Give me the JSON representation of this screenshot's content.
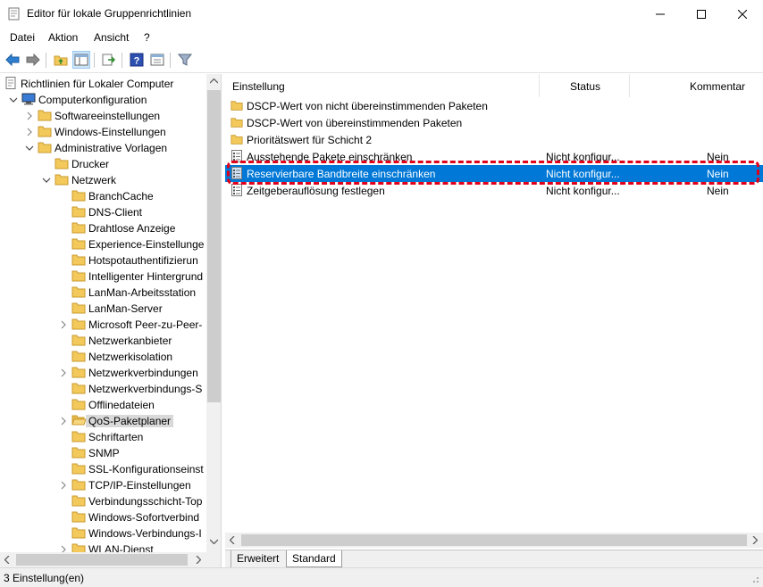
{
  "window": {
    "title": "Editor für lokale Gruppenrichtlinien"
  },
  "menu": [
    "Datei",
    "Aktion",
    "Ansicht",
    "?"
  ],
  "toolbar": {
    "icons": [
      "back-icon",
      "forward-icon",
      "up-folder-icon",
      "show-hide-tree-icon",
      "export-list-icon",
      "help-icon",
      "properties-icon",
      "filter-icon"
    ]
  },
  "tree": [
    {
      "label": "Richtlinien für Lokaler Computer",
      "icon": "policy",
      "expander": ""
    },
    {
      "label": "Computerkonfiguration",
      "icon": "computer",
      "expander": "open"
    },
    {
      "label": "Softwareeinstellungen",
      "icon": "folder",
      "expander": "closed"
    },
    {
      "label": "Windows-Einstellungen",
      "icon": "folder",
      "expander": "closed"
    },
    {
      "label": "Administrative Vorlagen",
      "icon": "folder",
      "expander": "open"
    },
    {
      "label": "Drucker",
      "icon": "folder",
      "expander": ""
    },
    {
      "label": "Netzwerk",
      "icon": "folder",
      "expander": "open"
    },
    {
      "label": "BranchCache",
      "icon": "folder",
      "expander": ""
    },
    {
      "label": "DNS-Client",
      "icon": "folder",
      "expander": ""
    },
    {
      "label": "Drahtlose Anzeige",
      "icon": "folder",
      "expander": ""
    },
    {
      "label": "Experience-Einstellunge",
      "icon": "folder",
      "expander": ""
    },
    {
      "label": "Hotspotauthentifizierun",
      "icon": "folder",
      "expander": ""
    },
    {
      "label": "Intelligenter Hintergrund",
      "icon": "folder",
      "expander": ""
    },
    {
      "label": "LanMan-Arbeitsstation",
      "icon": "folder",
      "expander": ""
    },
    {
      "label": "LanMan-Server",
      "icon": "folder",
      "expander": ""
    },
    {
      "label": "Microsoft Peer-zu-Peer-",
      "icon": "folder",
      "expander": "closed"
    },
    {
      "label": "Netzwerkanbieter",
      "icon": "folder",
      "expander": ""
    },
    {
      "label": "Netzwerkisolation",
      "icon": "folder",
      "expander": ""
    },
    {
      "label": "Netzwerkverbindungen",
      "icon": "folder",
      "expander": "closed"
    },
    {
      "label": "Netzwerkverbindungs-S",
      "icon": "folder",
      "expander": ""
    },
    {
      "label": "Offlinedateien",
      "icon": "folder",
      "expander": ""
    },
    {
      "label": "QoS-Paketplaner",
      "icon": "folder-open",
      "expander": "closed",
      "selected": true
    },
    {
      "label": "Schriftarten",
      "icon": "folder",
      "expander": ""
    },
    {
      "label": "SNMP",
      "icon": "folder",
      "expander": ""
    },
    {
      "label": "SSL-Konfigurationseinst",
      "icon": "folder",
      "expander": ""
    },
    {
      "label": "TCP/IP-Einstellungen",
      "icon": "folder",
      "expander": "closed"
    },
    {
      "label": "Verbindungsschicht-Top",
      "icon": "folder",
      "expander": ""
    },
    {
      "label": "Windows-Sofortverbind",
      "icon": "folder",
      "expander": ""
    },
    {
      "label": "Windows-Verbindungs-I",
      "icon": "folder",
      "expander": ""
    },
    {
      "label": "WLAN-Dienst",
      "icon": "folder",
      "expander": "closed"
    }
  ],
  "columns": {
    "setting": "Einstellung",
    "status": "Status",
    "comment": "Kommentar"
  },
  "rows": [
    {
      "name": "DSCP-Wert von nicht übereinstimmenden Paketen",
      "status": "",
      "comment": "",
      "icon": "folder"
    },
    {
      "name": "DSCP-Wert von übereinstimmenden Paketen",
      "status": "",
      "comment": "",
      "icon": "folder"
    },
    {
      "name": "Prioritätswert für Schicht 2",
      "status": "",
      "comment": "",
      "icon": "folder"
    },
    {
      "name": "Ausstehende Pakete einschränken",
      "status": "Nicht konfigur...",
      "comment": "Nein",
      "icon": "setting"
    },
    {
      "name": "Reservierbare Bandbreite einschränken",
      "status": "Nicht konfigur...",
      "comment": "Nein",
      "icon": "setting",
      "selected": true
    },
    {
      "name": "Zeitgeberauflösung festlegen",
      "status": "Nicht konfigur...",
      "comment": "Nein",
      "icon": "setting"
    }
  ],
  "tabs": {
    "extended": "Erweitert",
    "standard": "Standard"
  },
  "status_bar": {
    "text": "3 Einstellung(en)"
  },
  "colors": {
    "selection": "#0078d7",
    "highlight": "#e0001b",
    "folder": "#f3c95c"
  }
}
